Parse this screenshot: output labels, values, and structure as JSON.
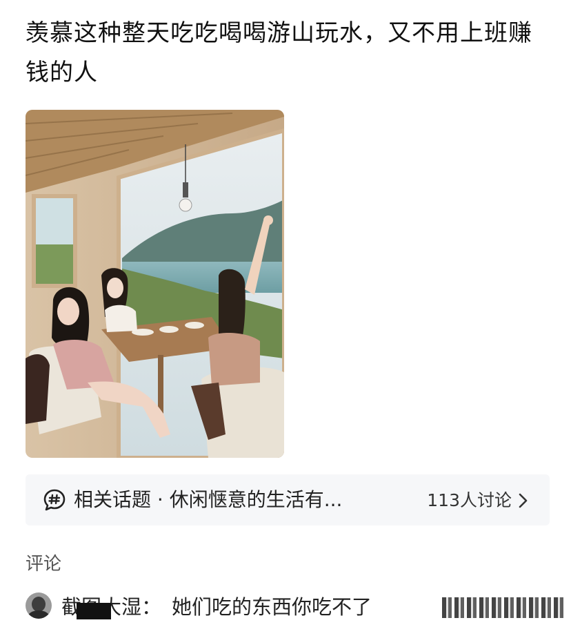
{
  "post": {
    "title": "羡慕这种整天吃吃喝喝游山玩水，又不用上班赚钱的人"
  },
  "topic": {
    "icon": "hashtag-chat-icon",
    "text": "相关话题 · 休闲惬意的生活有...",
    "count": "113人讨论",
    "chevron": "chevron-right-icon"
  },
  "comments": {
    "heading": "评论",
    "items": [
      {
        "name": "截图大湿：",
        "text": "她们吃的东西你吃不了"
      }
    ]
  }
}
